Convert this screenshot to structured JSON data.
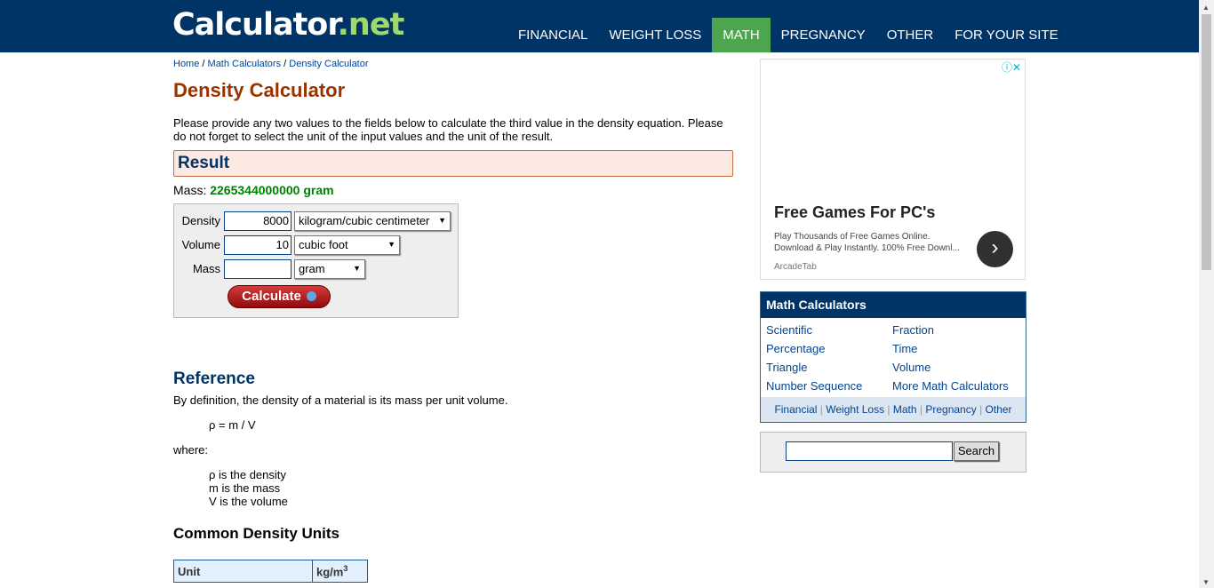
{
  "header": {
    "logo_main": "Calculator",
    "logo_net": ".net",
    "nav": [
      "FINANCIAL",
      "WEIGHT LOSS",
      "MATH",
      "PREGNANCY",
      "OTHER",
      "FOR YOUR SITE"
    ]
  },
  "breadcrumb": [
    "Home",
    "Math Calculators",
    "Density Calculator"
  ],
  "breadcrumb_sep": "/",
  "page_title": "Density Calculator",
  "intro": "Please provide any two values to the fields below to calculate the third value in the density equation. Please do not forget to select the unit of the input values and the unit of the result.",
  "result": {
    "title": "Result",
    "label": "Mass:",
    "value": "2265344000000 gram"
  },
  "form": {
    "density_label": "Density",
    "density_value": "8000",
    "density_unit": "kilogram/cubic centimeter",
    "volume_label": "Volume",
    "volume_value": "10",
    "volume_unit": "cubic foot",
    "mass_label": "Mass",
    "mass_value": "",
    "mass_unit": "gram",
    "calculate_label": "Calculate"
  },
  "reference": {
    "title": "Reference",
    "definition": "By definition, the density of a material is its mass per unit volume.",
    "formula": "ρ = m / V",
    "where": "where:",
    "vars": [
      "ρ is the density",
      "m is the mass",
      "V is the volume"
    ]
  },
  "common_units": {
    "title": "Common Density Units",
    "headers": [
      "Unit",
      "kg/m"
    ],
    "header_sup": "3"
  },
  "ad": {
    "title": "Free Games For PC's",
    "text": "Play Thousands of Free Games Online. Download & Play Instantly. 100% Free Downl...",
    "source": "ArcadeTab"
  },
  "math_calculators": {
    "title": "Math Calculators",
    "links_left": [
      "Scientific",
      "Percentage",
      "Triangle",
      "Number Sequence"
    ],
    "links_right": [
      "Fraction",
      "Time",
      "Volume",
      "More Math Calculators"
    ],
    "footer": [
      "Financial",
      "Weight Loss",
      "Math",
      "Pregnancy",
      "Other"
    ]
  },
  "search": {
    "button_label": "Search",
    "value": ""
  }
}
